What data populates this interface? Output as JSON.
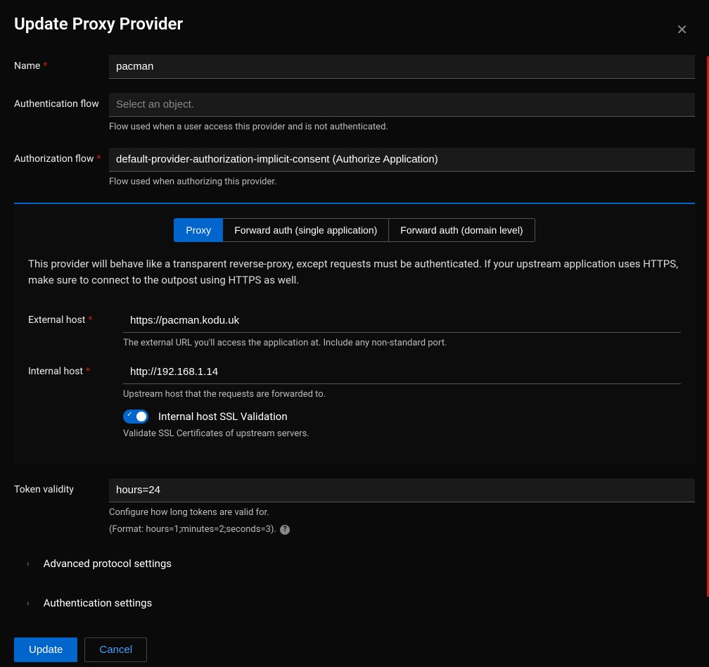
{
  "modal": {
    "title": "Update Proxy Provider"
  },
  "fields": {
    "name": {
      "label": "Name",
      "value": "pacman"
    },
    "authentication_flow": {
      "label": "Authentication flow",
      "placeholder": "Select an object.",
      "help": "Flow used when a user access this provider and is not authenticated."
    },
    "authorization_flow": {
      "label": "Authorization flow",
      "value": "default-provider-authorization-implicit-consent (Authorize Application)",
      "help": "Flow used when authorizing this provider."
    },
    "external_host": {
      "label": "External host",
      "value": "https://pacman.kodu.uk",
      "help": "The external URL you'll access the application at. Include any non-standard port."
    },
    "internal_host": {
      "label": "Internal host",
      "value": "http://192.168.1.14",
      "help": "Upstream host that the requests are forwarded to.",
      "ssl_toggle_label": "Internal host SSL Validation",
      "ssl_help": "Validate SSL Certificates of upstream servers."
    },
    "token_validity": {
      "label": "Token validity",
      "value": "hours=24",
      "help1": "Configure how long tokens are valid for.",
      "help2": "(Format: hours=1;minutes=2;seconds=3)."
    }
  },
  "tabs": {
    "proxy": "Proxy",
    "forward_single": "Forward auth (single application)",
    "forward_domain": "Forward auth (domain level)",
    "description": "This provider will behave like a transparent reverse-proxy, except requests must be authenticated. If your upstream application uses HTTPS, make sure to connect to the outpost using HTTPS as well."
  },
  "collapsibles": {
    "advanced": "Advanced protocol settings",
    "authentication": "Authentication settings"
  },
  "buttons": {
    "update": "Update",
    "cancel": "Cancel"
  }
}
